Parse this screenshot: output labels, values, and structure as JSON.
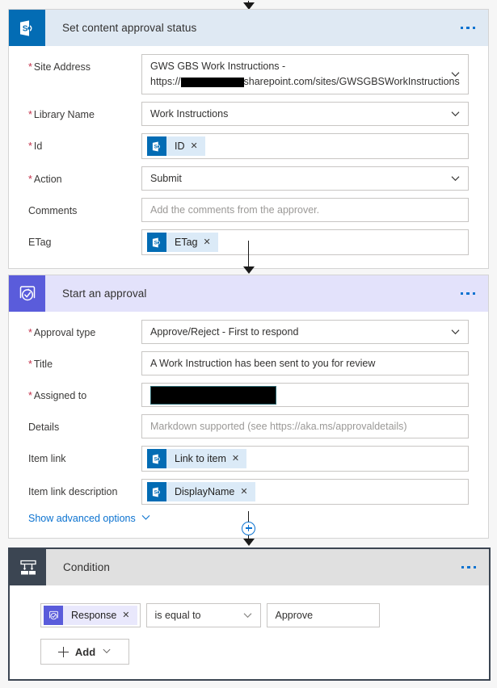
{
  "flow": {
    "top_connector": {
      "icon": "arrow-down-icon"
    },
    "cards": [
      {
        "id": "set-content-approval-status",
        "title": "Set content approval status",
        "icon": "sharepoint-icon",
        "menu_icon": "ellipsis-icon",
        "fields": [
          {
            "label": "Site Address",
            "required": true,
            "type": "dropdown",
            "value_line1": "GWS GBS Work Instructions -",
            "value_line2_prefix": "https://",
            "value_line2_redacted": true,
            "value_line2_suffix": "sharepoint.com/sites/GWSGBSWorkInstructions"
          },
          {
            "label": "Library Name",
            "required": true,
            "type": "dropdown",
            "value": "Work Instructions"
          },
          {
            "label": "Id",
            "required": true,
            "type": "token",
            "token": {
              "label": "ID",
              "icon": "sharepoint-icon",
              "remove_icon": "close-icon",
              "color": "blue"
            }
          },
          {
            "label": "Action",
            "required": true,
            "type": "dropdown",
            "value": "Submit"
          },
          {
            "label": "Comments",
            "required": false,
            "type": "text",
            "value": "",
            "placeholder": "Add the comments from the approver."
          },
          {
            "label": "ETag",
            "required": false,
            "type": "token",
            "token": {
              "label": "ETag",
              "icon": "sharepoint-icon",
              "remove_icon": "close-icon",
              "color": "blue"
            }
          }
        ]
      },
      {
        "id": "start-an-approval",
        "title": "Start an approval",
        "icon": "approval-icon",
        "menu_icon": "ellipsis-icon",
        "fields": [
          {
            "label": "Approval type",
            "required": true,
            "type": "dropdown",
            "value": "Approve/Reject - First to respond"
          },
          {
            "label": "Title",
            "required": true,
            "type": "text",
            "value": "A Work Instruction has been sent to you for review"
          },
          {
            "label": "Assigned to",
            "required": true,
            "type": "redacted"
          },
          {
            "label": "Details",
            "required": false,
            "type": "text",
            "value": "",
            "placeholder": "Markdown supported (see https://aka.ms/approvaldetails)"
          },
          {
            "label": "Item link",
            "required": false,
            "type": "token",
            "token": {
              "label": "Link to item",
              "icon": "sharepoint-icon",
              "remove_icon": "close-icon",
              "color": "blue"
            }
          },
          {
            "label": "Item link description",
            "required": false,
            "type": "token",
            "token": {
              "label": "DisplayName",
              "icon": "sharepoint-icon",
              "remove_icon": "close-icon",
              "color": "blue"
            }
          }
        ],
        "advanced_options_label": "Show advanced options",
        "advanced_options_icon": "chevron-down-icon"
      },
      {
        "id": "condition",
        "title": "Condition",
        "icon": "condition-branch-icon",
        "menu_icon": "ellipsis-icon",
        "expression": {
          "left_token": {
            "label": "Response",
            "icon": "approval-icon",
            "remove_icon": "close-icon",
            "color": "purple"
          },
          "operator": "is equal to",
          "operator_icon": "chevron-down-icon",
          "right_value": "Approve"
        },
        "add_button": {
          "label": "Add",
          "plus_icon": "plus-icon",
          "chevron_icon": "chevron-down-icon"
        }
      }
    ],
    "insert_step": {
      "icon": "plus-circle-icon"
    }
  },
  "colors": {
    "sharepoint_blue": "#036cb4",
    "sharepoint_header": "#dfe9f3",
    "approval_purple": "#5a5cdb",
    "approval_header": "#e3e2fb",
    "condition_dark": "#3b4552",
    "condition_header": "#e0e0e0",
    "accent_link": "#0b72d0",
    "required_red": "#c4314b",
    "page_background": "#f6f6f6"
  }
}
